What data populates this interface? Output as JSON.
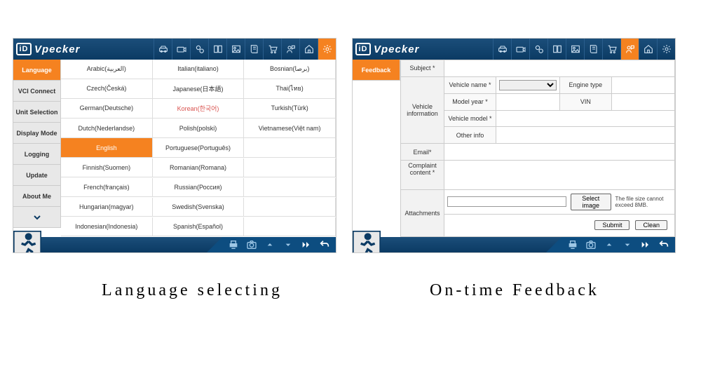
{
  "brand": "Vpecker",
  "logo_badge": "iD",
  "captions": {
    "left": "Language selecting",
    "right": "On-time Feedback"
  },
  "title_icons": [
    "car-front-icon",
    "camera-icon",
    "gear-pair-icon",
    "book-icon",
    "image-icon",
    "manual-icon",
    "cart-icon",
    "person-chat-icon",
    "home-icon",
    "settings-gear-icon"
  ],
  "left_active_title_icon_index": 9,
  "right_active_title_icon_index": 7,
  "left": {
    "sidebar": [
      "Language",
      "VCI Connect",
      "Unit Selection",
      "Display Mode",
      "Logging",
      "Update",
      "About Me"
    ],
    "sidebar_active_index": 0,
    "languages": {
      "col1": [
        "Arabic(العربية)",
        "Czech(Česká)",
        "German(Deutsche)",
        "Dutch(Nederlandse)",
        "English",
        "Finnish(Suomen)",
        "French(français)",
        "Hungarian(magyar)",
        "Indonesian(Indonesia)"
      ],
      "col2": [
        "Italian(italiano)",
        "Japanese(日本語)",
        "Korean(한국어)",
        "Polish(polski)",
        "Portuguese(Português)",
        "Romanian(Romana)",
        "Russian(Россия)",
        "Swedish(Svenska)",
        "Spanish(Español)"
      ],
      "col3": [
        "Bosnian(برصا)",
        "Thai(ไทย)",
        "Turkish(Türk)",
        "Vietnamese(Việt nam)",
        "",
        "",
        "",
        "",
        ""
      ]
    },
    "selected_language": "English"
  },
  "right": {
    "sidebar": [
      "Feedback"
    ],
    "sidebar_active_index": 0,
    "form": {
      "subject_label": "Subject *",
      "vehicle_info_label": "Vehicle information",
      "vehicle_name_label": "Vehicle name *",
      "engine_type_label": "Engine type",
      "model_year_label": "Model year *",
      "vin_label": "VIN",
      "vehicle_model_label": "Vehicle model *",
      "other_info_label": "Other info",
      "email_label": "Email*",
      "complaint_label": "Complaint content *",
      "attachments_label": "Attachments",
      "select_image_btn": "Select image",
      "file_hint": "The file size cannot exceed 8MB.",
      "submit_btn": "Submit",
      "clean_btn": "Clean"
    }
  }
}
